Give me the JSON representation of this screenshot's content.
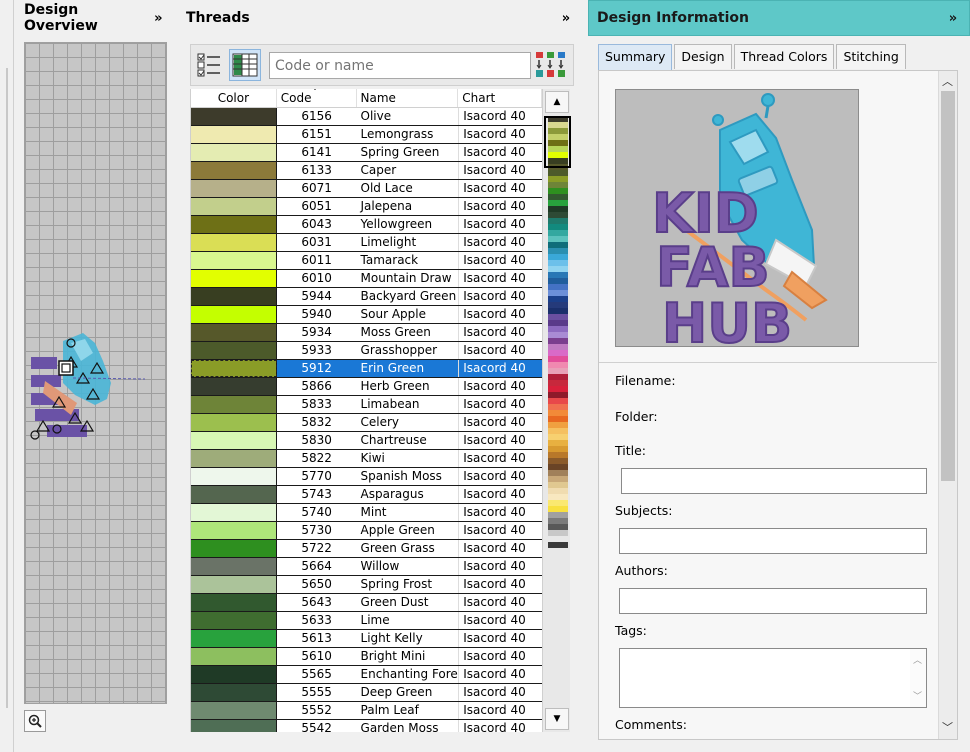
{
  "overview": {
    "title": "Design Overview",
    "collapse_icon": "double-chevron-right-icon",
    "zoom_icon": "zoom-in-icon"
  },
  "threads": {
    "title": "Threads",
    "collapse_icon": "double-chevron-right-icon",
    "search_placeholder": "Code or name",
    "columns": [
      "Color",
      "Code",
      "Name",
      "Chart"
    ],
    "sort_column": "Code",
    "selected_code": "5912",
    "rows": [
      {
        "color": "#3d3b2b",
        "code": "6156",
        "name": "Olive",
        "chart": "Isacord 40"
      },
      {
        "color": "#efeab0",
        "code": "6151",
        "name": "Lemongrass",
        "chart": "Isacord 40"
      },
      {
        "color": "#e4ecb2",
        "code": "6141",
        "name": "Spring Green",
        "chart": "Isacord 40"
      },
      {
        "color": "#8c7a3a",
        "code": "6133",
        "name": "Caper",
        "chart": "Isacord 40"
      },
      {
        "color": "#b6b08a",
        "code": "6071",
        "name": "Old Lace",
        "chart": "Isacord 40"
      },
      {
        "color": "#c2cf8c",
        "code": "6051",
        "name": "Jalepena",
        "chart": "Isacord 40"
      },
      {
        "color": "#6e7016",
        "code": "6043",
        "name": "Yellowgreen",
        "chart": "Isacord 40"
      },
      {
        "color": "#dade55",
        "code": "6031",
        "name": "Limelight",
        "chart": "Isacord 40"
      },
      {
        "color": "#d9f78f",
        "code": "6011",
        "name": "Tamarack",
        "chart": "Isacord 40"
      },
      {
        "color": "#e2ff00",
        "code": "6010",
        "name": "Mountain Draw",
        "chart": "Isacord 40"
      },
      {
        "color": "#383e21",
        "code": "5944",
        "name": "Backyard Green",
        "chart": "Isacord 40"
      },
      {
        "color": "#c4ff00",
        "code": "5940",
        "name": "Sour Apple",
        "chart": "Isacord 40"
      },
      {
        "color": "#56582a",
        "code": "5934",
        "name": "Moss Green",
        "chart": "Isacord 40"
      },
      {
        "color": "#4c5a2a",
        "code": "5933",
        "name": "Grasshopper",
        "chart": "Isacord 40"
      },
      {
        "color": "#8a9c27",
        "code": "5912",
        "name": "Erin Green",
        "chart": "Isacord 40"
      },
      {
        "color": "#363d2f",
        "code": "5866",
        "name": "Herb Green",
        "chart": "Isacord 40"
      },
      {
        "color": "#6e8438",
        "code": "5833",
        "name": "Limabean",
        "chart": "Isacord 40"
      },
      {
        "color": "#9cbf4e",
        "code": "5832",
        "name": "Celery",
        "chart": "Isacord 40"
      },
      {
        "color": "#d8f7b4",
        "code": "5830",
        "name": "Chartreuse",
        "chart": "Isacord 40"
      },
      {
        "color": "#9eac7a",
        "code": "5822",
        "name": "Kiwi",
        "chart": "Isacord 40"
      },
      {
        "color": "#eef7ec",
        "code": "5770",
        "name": "Spanish Moss",
        "chart": "Isacord 40"
      },
      {
        "color": "#54664f",
        "code": "5743",
        "name": "Asparagus",
        "chart": "Isacord 40"
      },
      {
        "color": "#e3f7d6",
        "code": "5740",
        "name": "Mint",
        "chart": "Isacord 40"
      },
      {
        "color": "#aee67a",
        "code": "5730",
        "name": "Apple Green",
        "chart": "Isacord 40"
      },
      {
        "color": "#2e8f1f",
        "code": "5722",
        "name": "Green Grass",
        "chart": "Isacord 40"
      },
      {
        "color": "#6a7367",
        "code": "5664",
        "name": "Willow",
        "chart": "Isacord 40"
      },
      {
        "color": "#abc39a",
        "code": "5650",
        "name": "Spring Frost",
        "chart": "Isacord 40"
      },
      {
        "color": "#31592f",
        "code": "5643",
        "name": "Green Dust",
        "chart": "Isacord 40"
      },
      {
        "color": "#3f6d30",
        "code": "5633",
        "name": "Lime",
        "chart": "Isacord 40"
      },
      {
        "color": "#28a23d",
        "code": "5613",
        "name": "Light Kelly",
        "chart": "Isacord 40"
      },
      {
        "color": "#8dbf5f",
        "code": "5610",
        "name": "Bright Mini",
        "chart": "Isacord 40"
      },
      {
        "color": "#1f3a26",
        "code": "5565",
        "name": "Enchanting Fores",
        "chart": "Isacord 40"
      },
      {
        "color": "#2e4a35",
        "code": "5555",
        "name": "Deep Green",
        "chart": "Isacord 40"
      },
      {
        "color": "#6f8a70",
        "code": "5552",
        "name": "Palm Leaf",
        "chart": "Isacord 40"
      },
      {
        "color": "#4f6e55",
        "code": "5542",
        "name": "Garden Moss",
        "chart": "Isacord 40"
      }
    ],
    "strip_colors": [
      "#3d3b2b",
      "#d9d890",
      "#8c9a3a",
      "#c4d06a",
      "#6e7016",
      "#b7d65a",
      "#e2ff00",
      "#383e21",
      "#56582a",
      "#4c5a2a",
      "#8a9c27",
      "#6e8438",
      "#2e8f1f",
      "#31592f",
      "#28a23d",
      "#1f3a26",
      "#2e4a35",
      "#1e7a6c",
      "#128a7e",
      "#33a8a0",
      "#5bc2bd",
      "#0f6d7a",
      "#2a8fb0",
      "#3aa8d8",
      "#6cc0ea",
      "#8fd3f0",
      "#2877b5",
      "#1f5d9c",
      "#4472c4",
      "#6c8fd8",
      "#1b3f8a",
      "#253a7a",
      "#1a2f6b",
      "#6a4fa0",
      "#5a3a8a",
      "#8d6ac0",
      "#a98bd4",
      "#7a3e8e",
      "#c07ac2",
      "#d96ac8",
      "#e24d9a",
      "#f089b0",
      "#e8a0b8",
      "#b01e3a",
      "#c7283c",
      "#d8203a",
      "#8e1a2a",
      "#e8484a",
      "#f07050",
      "#f28a38",
      "#e86820",
      "#f0a040",
      "#f5c060",
      "#f7d070",
      "#e8b040",
      "#d89a30",
      "#b8782a",
      "#8a5a2a",
      "#6a4426",
      "#a0805a",
      "#c8a878",
      "#e0c890",
      "#f0dcb0",
      "#f8e8c0",
      "#fae870",
      "#f8e040",
      "#a0a0a0",
      "#7a7a7a",
      "#585858",
      "#c8c8c8",
      "#e8e8e8",
      "#3a3a3a"
    ]
  },
  "info": {
    "title": "Design Information",
    "collapse_icon": "double-chevron-right-icon",
    "tabs": [
      "Summary",
      "Design",
      "Thread Colors",
      "Stitching"
    ],
    "active_tab": "Summary",
    "preview": {
      "lines": [
        "KID",
        "FAB",
        "HUB"
      ],
      "robot_color": "#3fb6d6",
      "text_color": "#7a5aa8",
      "accent_color": "#f0a060",
      "bg_color": "#bdbdbd"
    },
    "labels": {
      "filename": "Filename:",
      "folder": "Folder:",
      "title": "Title:",
      "subjects": "Subjects:",
      "authors": "Authors:",
      "tags": "Tags:",
      "comments": "Comments:"
    },
    "values": {
      "title": "",
      "subjects": "",
      "authors": "",
      "tags": ""
    }
  },
  "colors": {
    "accent_header": "#5ec8c8",
    "selection": "#1a78d6"
  }
}
